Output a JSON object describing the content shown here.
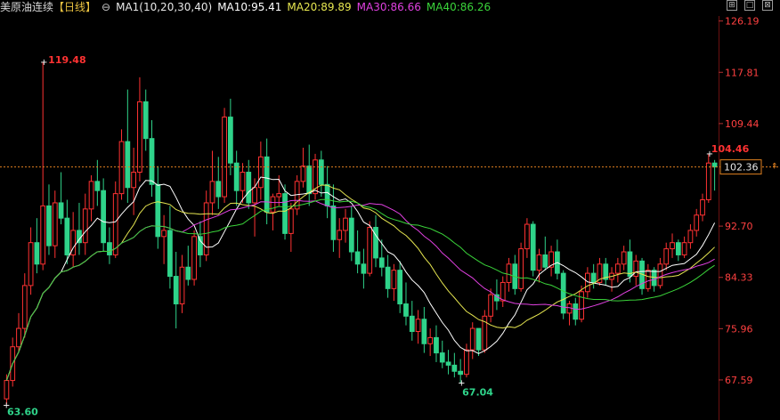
{
  "header": {
    "instrument": "美原油连续",
    "period": "【日线】",
    "ma_group": "MA1(10,20,30,40)",
    "ma10": "MA10:95.41",
    "ma20": "MA20:89.89",
    "ma30": "MA30:86.66",
    "ma40": "MA40:86.26"
  },
  "tools": [
    "⊞",
    "□",
    "⊠"
  ],
  "colors": {
    "up": "#ff3232",
    "down": "#2fd38a",
    "ma10": "#ffffff",
    "ma20": "#e6e650",
    "ma30": "#e040e0",
    "ma40": "#3ad43a",
    "axis_text": "#ff4040",
    "price_line": "#e08020"
  },
  "chart_data": {
    "type": "candlestick",
    "ylim": [
      62.5,
      127.0
    ],
    "y_ticks": [
      126.19,
      117.81,
      109.44,
      92.7,
      84.33,
      75.96,
      67.59
    ],
    "current_price": 102.36,
    "annotations": {
      "high": "119.48",
      "low": "67.04",
      "recent_high": "104.46",
      "start_low": "63.60"
    },
    "candles": [
      [
        64.5,
        68.5,
        63.6,
        67.5
      ],
      [
        67.5,
        74.5,
        66.5,
        73.0
      ],
      [
        73.0,
        78.5,
        72.0,
        76.0
      ],
      [
        76.0,
        85.0,
        74.5,
        83.0
      ],
      [
        83.0,
        92.5,
        81.5,
        90.0
      ],
      [
        90.0,
        94.0,
        85.0,
        86.5
      ],
      [
        86.5,
        119.48,
        85.5,
        96.0
      ],
      [
        96.0,
        99.5,
        88.0,
        89.5
      ],
      [
        89.5,
        98.5,
        87.5,
        96.5
      ],
      [
        96.5,
        101.5,
        93.0,
        94.0
      ],
      [
        94.0,
        97.0,
        86.5,
        88.0
      ],
      [
        88.0,
        95.0,
        86.0,
        92.0
      ],
      [
        92.0,
        96.5,
        88.0,
        90.0
      ],
      [
        90.0,
        98.0,
        88.0,
        95.5
      ],
      [
        95.5,
        101.0,
        93.5,
        100.0
      ],
      [
        100.0,
        103.5,
        96.0,
        98.5
      ],
      [
        98.5,
        100.5,
        88.5,
        90.0
      ],
      [
        90.0,
        92.5,
        86.5,
        88.0
      ],
      [
        88.0,
        100.0,
        87.5,
        98.0
      ],
      [
        98.0,
        108.5,
        97.0,
        106.5
      ],
      [
        106.5,
        115.0,
        96.5,
        99.0
      ],
      [
        99.0,
        105.5,
        94.5,
        101.5
      ],
      [
        101.5,
        117.0,
        100.0,
        113.0
      ],
      [
        113.0,
        115.0,
        105.0,
        107.0
      ],
      [
        107.0,
        110.0,
        97.5,
        99.5
      ],
      [
        99.5,
        102.5,
        89.0,
        91.0
      ],
      [
        91.0,
        94.5,
        86.5,
        92.0
      ],
      [
        92.0,
        96.0,
        82.5,
        84.5
      ],
      [
        84.5,
        88.5,
        76.0,
        80.0
      ],
      [
        80.0,
        88.0,
        78.5,
        86.0
      ],
      [
        86.0,
        89.5,
        83.0,
        84.0
      ],
      [
        84.0,
        92.0,
        83.0,
        91.0
      ],
      [
        91.0,
        93.5,
        86.0,
        88.0
      ],
      [
        88.0,
        98.5,
        87.0,
        96.5
      ],
      [
        96.5,
        105.0,
        94.5,
        100.0
      ],
      [
        100.0,
        104.0,
        95.5,
        97.5
      ],
      [
        97.5,
        112.0,
        96.5,
        110.5
      ],
      [
        110.5,
        113.5,
        101.0,
        103.0
      ],
      [
        103.0,
        105.0,
        96.0,
        98.5
      ],
      [
        98.5,
        103.0,
        96.5,
        101.5
      ],
      [
        101.5,
        103.5,
        95.5,
        96.5
      ],
      [
        96.5,
        100.5,
        91.0,
        99.0
      ],
      [
        99.0,
        106.5,
        97.0,
        104.0
      ],
      [
        104.0,
        107.0,
        93.0,
        95.0
      ],
      [
        95.0,
        98.0,
        92.0,
        97.5
      ],
      [
        97.5,
        101.0,
        96.0,
        98.0
      ],
      [
        98.0,
        99.5,
        90.5,
        91.5
      ],
      [
        91.5,
        96.5,
        88.5,
        95.5
      ],
      [
        95.5,
        101.0,
        94.5,
        100.0
      ],
      [
        100.0,
        105.5,
        99.0,
        102.5
      ],
      [
        102.5,
        106.0,
        96.0,
        98.0
      ],
      [
        98.0,
        104.5,
        97.0,
        103.5
      ],
      [
        103.5,
        105.0,
        97.5,
        99.5
      ],
      [
        99.5,
        102.5,
        94.0,
        96.0
      ],
      [
        96.0,
        99.5,
        88.5,
        90.5
      ],
      [
        90.5,
        94.0,
        87.5,
        92.0
      ],
      [
        92.0,
        95.5,
        90.0,
        94.0
      ],
      [
        94.0,
        96.0,
        87.0,
        88.5
      ],
      [
        88.5,
        92.0,
        85.0,
        86.5
      ],
      [
        86.5,
        89.0,
        82.5,
        85.0
      ],
      [
        85.0,
        93.5,
        84.5,
        92.5
      ],
      [
        92.5,
        94.5,
        86.0,
        87.5
      ],
      [
        87.5,
        90.5,
        84.5,
        86.0
      ],
      [
        86.0,
        88.0,
        81.0,
        82.5
      ],
      [
        82.5,
        86.5,
        80.5,
        85.5
      ],
      [
        85.5,
        87.0,
        78.5,
        80.0
      ],
      [
        80.0,
        83.5,
        76.5,
        78.0
      ],
      [
        78.0,
        80.5,
        74.0,
        75.5
      ],
      [
        75.5,
        79.0,
        73.5,
        77.5
      ],
      [
        77.5,
        79.5,
        72.0,
        73.5
      ],
      [
        73.5,
        76.0,
        71.5,
        74.5
      ],
      [
        74.5,
        76.5,
        70.5,
        72.0
      ],
      [
        72.0,
        74.0,
        69.5,
        70.5
      ],
      [
        70.5,
        72.5,
        68.5,
        70.0
      ],
      [
        70.0,
        72.0,
        68.0,
        69.0
      ],
      [
        69.0,
        71.0,
        67.04,
        68.5
      ],
      [
        68.5,
        73.5,
        68.0,
        72.5
      ],
      [
        72.5,
        77.0,
        71.0,
        76.0
      ],
      [
        76.0,
        75.5,
        71.5,
        72.5
      ],
      [
        72.5,
        79.0,
        72.0,
        78.0
      ],
      [
        78.0,
        82.5,
        77.0,
        81.5
      ],
      [
        81.5,
        84.0,
        79.0,
        80.5
      ],
      [
        80.5,
        84.5,
        79.5,
        83.5
      ],
      [
        83.5,
        87.5,
        82.0,
        86.5
      ],
      [
        86.5,
        88.0,
        81.5,
        82.5
      ],
      [
        82.5,
        90.0,
        82.0,
        89.0
      ],
      [
        89.0,
        94.0,
        87.5,
        93.0
      ],
      [
        93.0,
        93.5,
        84.5,
        85.5
      ],
      [
        85.5,
        89.0,
        83.5,
        88.0
      ],
      [
        88.0,
        91.0,
        85.5,
        86.0
      ],
      [
        86.0,
        89.5,
        84.5,
        88.5
      ],
      [
        88.5,
        90.5,
        84.0,
        85.0
      ],
      [
        85.0,
        85.5,
        77.5,
        78.5
      ],
      [
        78.5,
        80.5,
        76.5,
        80.0
      ],
      [
        80.0,
        81.0,
        76.5,
        77.5
      ],
      [
        77.5,
        83.0,
        77.0,
        82.0
      ],
      [
        82.0,
        86.0,
        81.0,
        85.0
      ],
      [
        85.0,
        86.5,
        82.5,
        83.5
      ],
      [
        83.5,
        87.5,
        83.0,
        86.5
      ],
      [
        86.5,
        87.5,
        83.0,
        84.0
      ],
      [
        84.0,
        86.0,
        82.0,
        85.0
      ],
      [
        85.0,
        87.5,
        83.5,
        86.5
      ],
      [
        86.5,
        89.5,
        85.5,
        88.5
      ],
      [
        88.5,
        90.5,
        83.5,
        84.5
      ],
      [
        84.5,
        88.0,
        83.0,
        87.0
      ],
      [
        87.0,
        87.5,
        81.5,
        82.5
      ],
      [
        82.5,
        86.5,
        82.0,
        85.5
      ],
      [
        85.5,
        86.0,
        82.0,
        83.0
      ],
      [
        83.0,
        87.5,
        82.5,
        86.5
      ],
      [
        86.5,
        90.0,
        85.5,
        89.0
      ],
      [
        89.0,
        91.5,
        87.5,
        90.0
      ],
      [
        90.0,
        90.5,
        87.0,
        88.0
      ],
      [
        88.0,
        91.0,
        87.5,
        90.0
      ],
      [
        90.0,
        93.0,
        89.0,
        92.0
      ],
      [
        92.0,
        95.5,
        91.0,
        94.5
      ],
      [
        94.5,
        98.0,
        93.5,
        97.0
      ],
      [
        97.0,
        104.46,
        96.5,
        103.0
      ],
      [
        103.0,
        103.5,
        98.5,
        102.36
      ]
    ]
  }
}
